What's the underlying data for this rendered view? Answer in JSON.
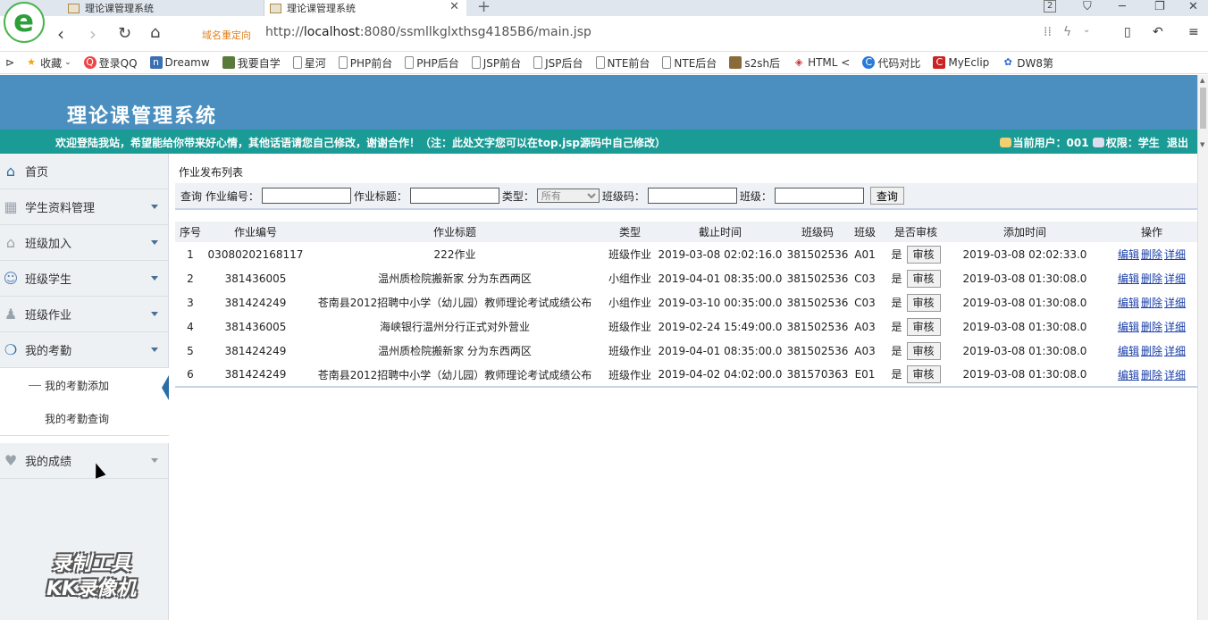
{
  "browser": {
    "logo_letter": "e",
    "tabs": [
      {
        "label": "理论课管理系统"
      },
      {
        "label": "理论课管理系统"
      }
    ],
    "tab_badge": "2",
    "new_tab": "+",
    "redirect_label": "域名重定向",
    "url_prefix": "http://",
    "url_host": "localhost",
    "url_rest": ":8080/ssmllkglxthsg4185B6/main.jsp",
    "bookmarks": [
      {
        "label": "收藏",
        "icon": "star-icon"
      },
      {
        "label": "登录QQ",
        "icon": "qq-icon"
      },
      {
        "label": "Dreamw",
        "icon": "dreamweaver-icon"
      },
      {
        "label": "我要自学",
        "icon": "bookmark-image-icon"
      },
      {
        "label": "星河",
        "icon": "page-icon"
      },
      {
        "label": "PHP前台",
        "icon": "page-icon"
      },
      {
        "label": "PHP后台",
        "icon": "page-icon"
      },
      {
        "label": "JSP前台",
        "icon": "page-icon"
      },
      {
        "label": "JSP后台",
        "icon": "page-icon"
      },
      {
        "label": "NTE前台",
        "icon": "page-icon"
      },
      {
        "label": "NTE后台",
        "icon": "page-icon"
      },
      {
        "label": "s2sh后",
        "icon": "bookmark-image-icon"
      },
      {
        "label": "HTML <",
        "icon": "html-icon"
      },
      {
        "label": "代码对比",
        "icon": "compare-icon"
      },
      {
        "label": "MyEclip",
        "icon": "myeclipse-icon"
      },
      {
        "label": "DW8第",
        "icon": "paw-icon"
      }
    ]
  },
  "header": {
    "title": "理论课管理系统",
    "welcome": "欢迎登陆我站，希望能给你带来好心情，其他话语请您自己修改，谢谢合作！（注：此处文字您可以在top.jsp源码中自己修改）",
    "current_user_label": "当前用户：001",
    "permission_label": "权限：学生",
    "logout": "退出"
  },
  "sidebar": {
    "items": [
      {
        "label": "首页",
        "icon": "home-icon"
      },
      {
        "label": "学生资料管理",
        "icon": "grid-icon"
      },
      {
        "label": "班级加入",
        "icon": "house-icon"
      },
      {
        "label": "班级学生",
        "icon": "users-icon"
      },
      {
        "label": "班级作业",
        "icon": "user-icon"
      },
      {
        "label": "我的考勤",
        "icon": "chat-icon"
      },
      {
        "label": "我的成绩",
        "icon": "heart-icon"
      }
    ],
    "sub_items": [
      {
        "label": "我的考勤添加"
      },
      {
        "label": "我的考勤查询"
      }
    ],
    "watermark_line1": "录制工具",
    "watermark_line2": "KK录像机"
  },
  "main": {
    "section_title": "作业发布列表",
    "search": {
      "prefix": "查询",
      "id_label": "作业编号：",
      "title_label": "作业标题：",
      "type_label": "类型：",
      "type_selected": "所有",
      "class_code_label": "班级码：",
      "class_label": "班级：",
      "button": "查询"
    },
    "table": {
      "columns": [
        "序号",
        "作业编号",
        "作业标题",
        "类型",
        "截止时间",
        "班级码",
        "班级",
        "是否审核",
        "添加时间",
        "操作"
      ],
      "review_button": "审核",
      "actions": [
        "编辑",
        "删除",
        "详细"
      ],
      "rows": [
        {
          "no": "1",
          "id": "03080202168117",
          "title": "222作业",
          "type": "班级作业",
          "deadline": "2019-03-08 02:02:16.0",
          "class_code": "381502536",
          "class": "A01",
          "reviewed": "是",
          "added": "2019-03-08 02:02:33.0"
        },
        {
          "no": "2",
          "id": "381436005",
          "title": "温州质检院搬新家 分为东西两区",
          "type": "小组作业",
          "deadline": "2019-04-01 08:35:00.0",
          "class_code": "381502536",
          "class": "C03",
          "reviewed": "是",
          "added": "2019-03-08 01:30:08.0"
        },
        {
          "no": "3",
          "id": "381424249",
          "title": "苍南县2012招聘中小学（幼儿园）教师理论考试成绩公布",
          "type": "小组作业",
          "deadline": "2019-03-10 00:35:00.0",
          "class_code": "381502536",
          "class": "C03",
          "reviewed": "是",
          "added": "2019-03-08 01:30:08.0"
        },
        {
          "no": "4",
          "id": "381436005",
          "title": "海峡银行温州分行正式对外营业",
          "type": "班级作业",
          "deadline": "2019-02-24 15:49:00.0",
          "class_code": "381502536",
          "class": "A03",
          "reviewed": "是",
          "added": "2019-03-08 01:30:08.0"
        },
        {
          "no": "5",
          "id": "381424249",
          "title": "温州质检院搬新家 分为东西两区",
          "type": "班级作业",
          "deadline": "2019-04-01 08:35:00.0",
          "class_code": "381502536",
          "class": "A03",
          "reviewed": "是",
          "added": "2019-03-08 01:30:08.0"
        },
        {
          "no": "6",
          "id": "381424249",
          "title": "苍南县2012招聘中小学（幼儿园）教师理论考试成绩公布",
          "type": "班级作业",
          "deadline": "2019-04-02 04:02:00.0",
          "class_code": "381570363",
          "class": "E01",
          "reviewed": "是",
          "added": "2019-03-08 01:30:08.0"
        }
      ]
    }
  },
  "colors": {
    "header_bg": "#4a8fbf",
    "marquee_bg": "#1a9b95",
    "link": "#1a3ea8",
    "sidebar_bg": "#eef1f4"
  }
}
